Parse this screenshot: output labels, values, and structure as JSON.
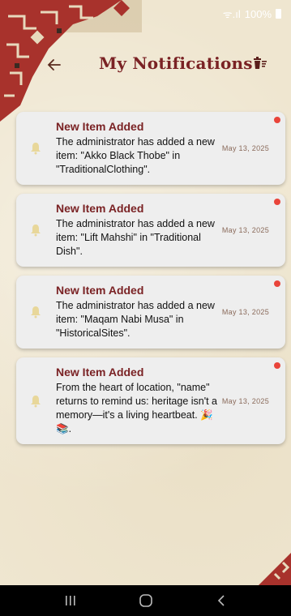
{
  "status": {
    "signal_text": "ᯤ.ıl",
    "battery_text": "100%"
  },
  "header": {
    "title": "My Notifications"
  },
  "notifications": [
    {
      "title": "New Item Added",
      "body": "The administrator has added a new item: \"Akko Black Thobe\" in \"TraditionalClothing\".",
      "date": "May 13, 2025",
      "unread": true
    },
    {
      "title": "New Item Added",
      "body": "The administrator has added a new item: \"Lift Mahshi\" in \"Traditional Dish\".",
      "date": "May 13, 2025",
      "unread": true
    },
    {
      "title": "New Item Added",
      "body": "The administrator has added a new item: \"Maqam Nabi Musa\" in \"HistoricalSites\".",
      "date": "May 13, 2025",
      "unread": true
    },
    {
      "title": "New Item Added",
      "body": "From the heart of location, \"name\" returns to remind us: heritage isn't a memory—it's a living heartbeat. 🎉📚.",
      "date": "May 13, 2025",
      "unread": true
    }
  ],
  "colors": {
    "accent": "#7a2224",
    "unread_dot": "#e9443a",
    "card_bg": "#eeeeee"
  },
  "icons": {
    "back": "arrow-left-icon",
    "clear": "trash-icon",
    "bell": "bell-icon"
  }
}
